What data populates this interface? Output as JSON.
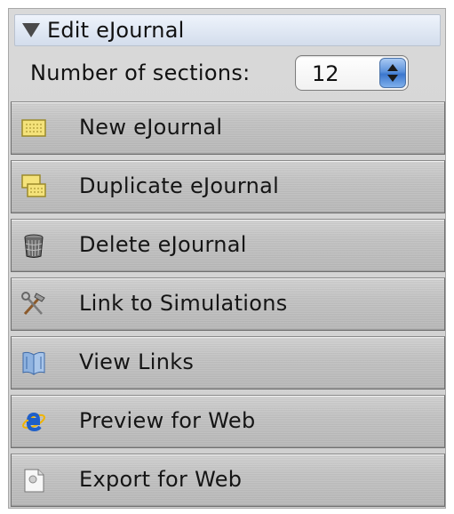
{
  "panel": {
    "header_title": "Edit eJournal",
    "sections_label": "Number of sections:",
    "sections_value": "12"
  },
  "buttons": [
    {
      "label": "New eJournal",
      "icon": "notepad-icon"
    },
    {
      "label": "Duplicate eJournal",
      "icon": "duplicate-notepad-icon"
    },
    {
      "label": "Delete eJournal",
      "icon": "trash-icon"
    },
    {
      "label": "Link to Simulations",
      "icon": "tools-icon"
    },
    {
      "label": "View Links",
      "icon": "book-icon"
    },
    {
      "label": "Preview for Web",
      "icon": "internet-explorer-icon"
    },
    {
      "label": "Export for Web",
      "icon": "export-document-icon"
    }
  ],
  "colors": {
    "header_bg": "#dfe7f3",
    "stepper_accent": "#5d93dc",
    "button_bg": "#c3c3c3"
  }
}
